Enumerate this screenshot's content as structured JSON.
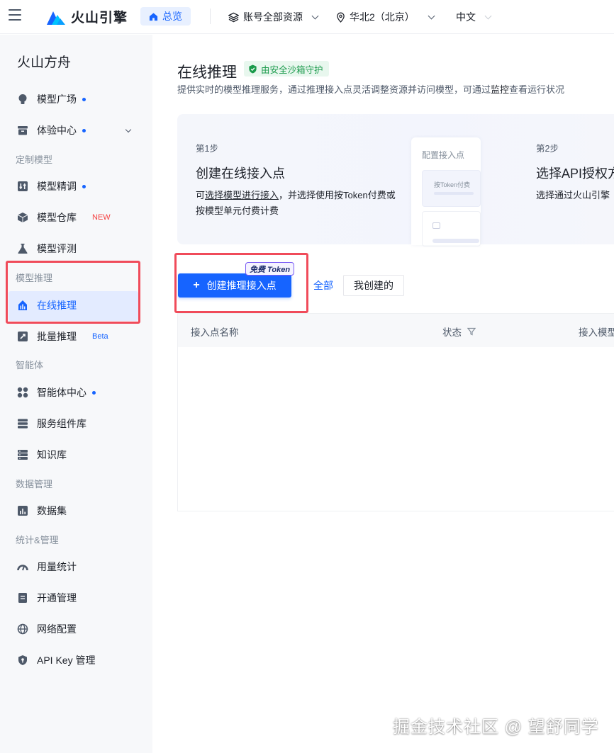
{
  "topbar": {
    "brand": "火山引擎",
    "home": "总览",
    "account": "账号全部资源",
    "region": "华北2（北京）",
    "lang": "中文"
  },
  "sidebar": {
    "title": "火山方舟",
    "items": {
      "model_square": "模型广场",
      "experience": "体验中心",
      "finetune": "模型精调",
      "repo": "模型仓库",
      "repo_badge": "NEW",
      "eval": "模型评测",
      "online": "在线推理",
      "batch": "批量推理",
      "batch_badge": "Beta",
      "agent_center": "智能体中心",
      "components": "服务组件库",
      "knowledge": "知识库",
      "dataset": "数据集",
      "usage": "用量统计",
      "activation": "开通管理",
      "network": "网络配置",
      "apikey": "API Key 管理"
    },
    "groups": {
      "custom": "定制模型",
      "inference": "模型推理",
      "agent": "智能体",
      "data": "数据管理",
      "stats": "统计&管理"
    }
  },
  "main": {
    "title": "在线推理",
    "safe_badge": "由安全沙箱守护",
    "subtitle_a": "提供实时的模型推理服务，通过推理接入点灵活调整资源并访问模型，可通过",
    "subtitle_link": "监控",
    "subtitle_b": "查看运行状况",
    "step1": {
      "label": "第1步",
      "title": "创建在线接入点",
      "desc_a": "可",
      "desc_link": "选择模型进行接入",
      "desc_b": "，并选择使用按Token付费或",
      "desc_c": "按模型单元付费计费"
    },
    "mock": {
      "title": "配置接入点",
      "row": "按Token付费"
    },
    "step2": {
      "label": "第2步",
      "title": "选择API授权方",
      "desc": "选择通过火山引擎"
    },
    "create_button": "创建推理接入点",
    "token_tag": "免费 Token",
    "filters": {
      "all": "全部",
      "mine": "我创建的"
    },
    "table": {
      "columns": [
        "接入点名称",
        "状态",
        "接入模型"
      ]
    }
  },
  "watermark": "掘金技术社区 @ 望舒同学"
}
